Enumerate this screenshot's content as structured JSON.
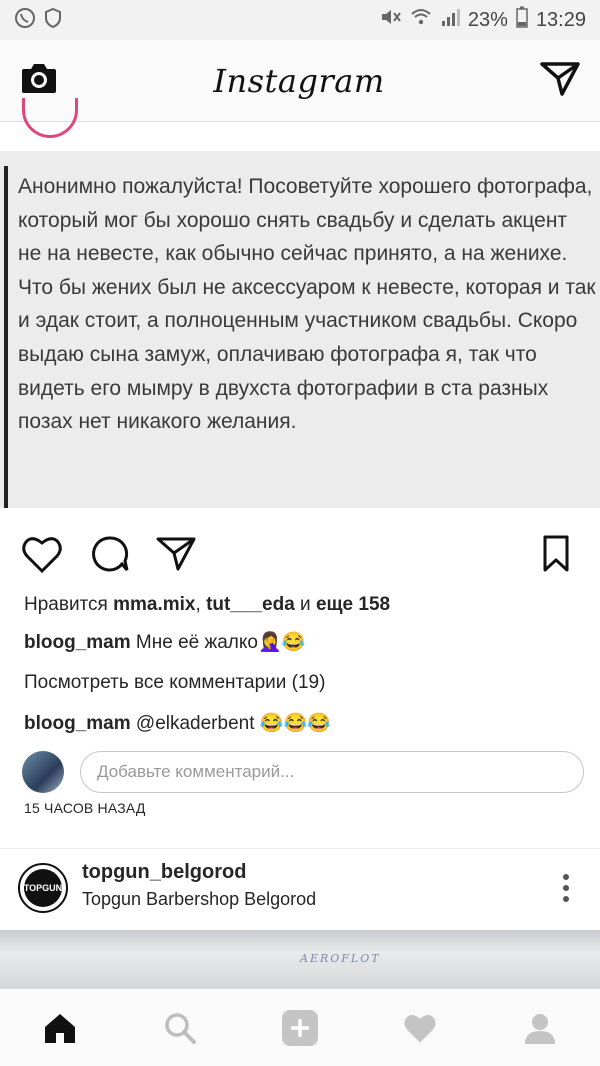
{
  "status_bar": {
    "battery": "23%",
    "time": "13:29"
  },
  "app_bar": {
    "logo": "Instagram"
  },
  "post": {
    "text": "Анонимно пожалуйста! Посоветуйте хорошего фотографа, который мог бы хорошо снять свадьбу и сделать акцент не на невесте, как обычно сейчас принято, а на женихе. Что бы жених был не аксессуаром к невесте, которая и так и эдак стоит, а полноценным участником свадьбы. Скоро выдаю сына замуж, оплачиваю фотографа я, так что видеть его мымру в двухста фотографии в ста разных позах нет никакого желания.",
    "likes": {
      "prefix": "Нравится",
      "user1": "mma.mix",
      "sep": ",",
      "user2": "tut___eda",
      "and": "и",
      "more": "еще 158"
    },
    "comment1": {
      "user": "bloog_mam",
      "text": "Мне её жалко",
      "emoji": "🤦‍♀️😂"
    },
    "view_all": "Посмотреть все комментарии (19)",
    "comment2": {
      "user": "bloog_mam",
      "text": "@elkaderbent",
      "emoji": "😂😂😂"
    },
    "comment_placeholder": "Добавьте комментарий...",
    "time_ago": "15 ЧАСОВ НАЗАД"
  },
  "next_post": {
    "username": "topgun_belgorod",
    "location": "Topgun Barbershop Belgorod",
    "avatar_text": "TOPGUN",
    "image_text": "AEROFLOT"
  },
  "colors": {
    "accent_ring": "#e0457b",
    "text": "#262626"
  }
}
